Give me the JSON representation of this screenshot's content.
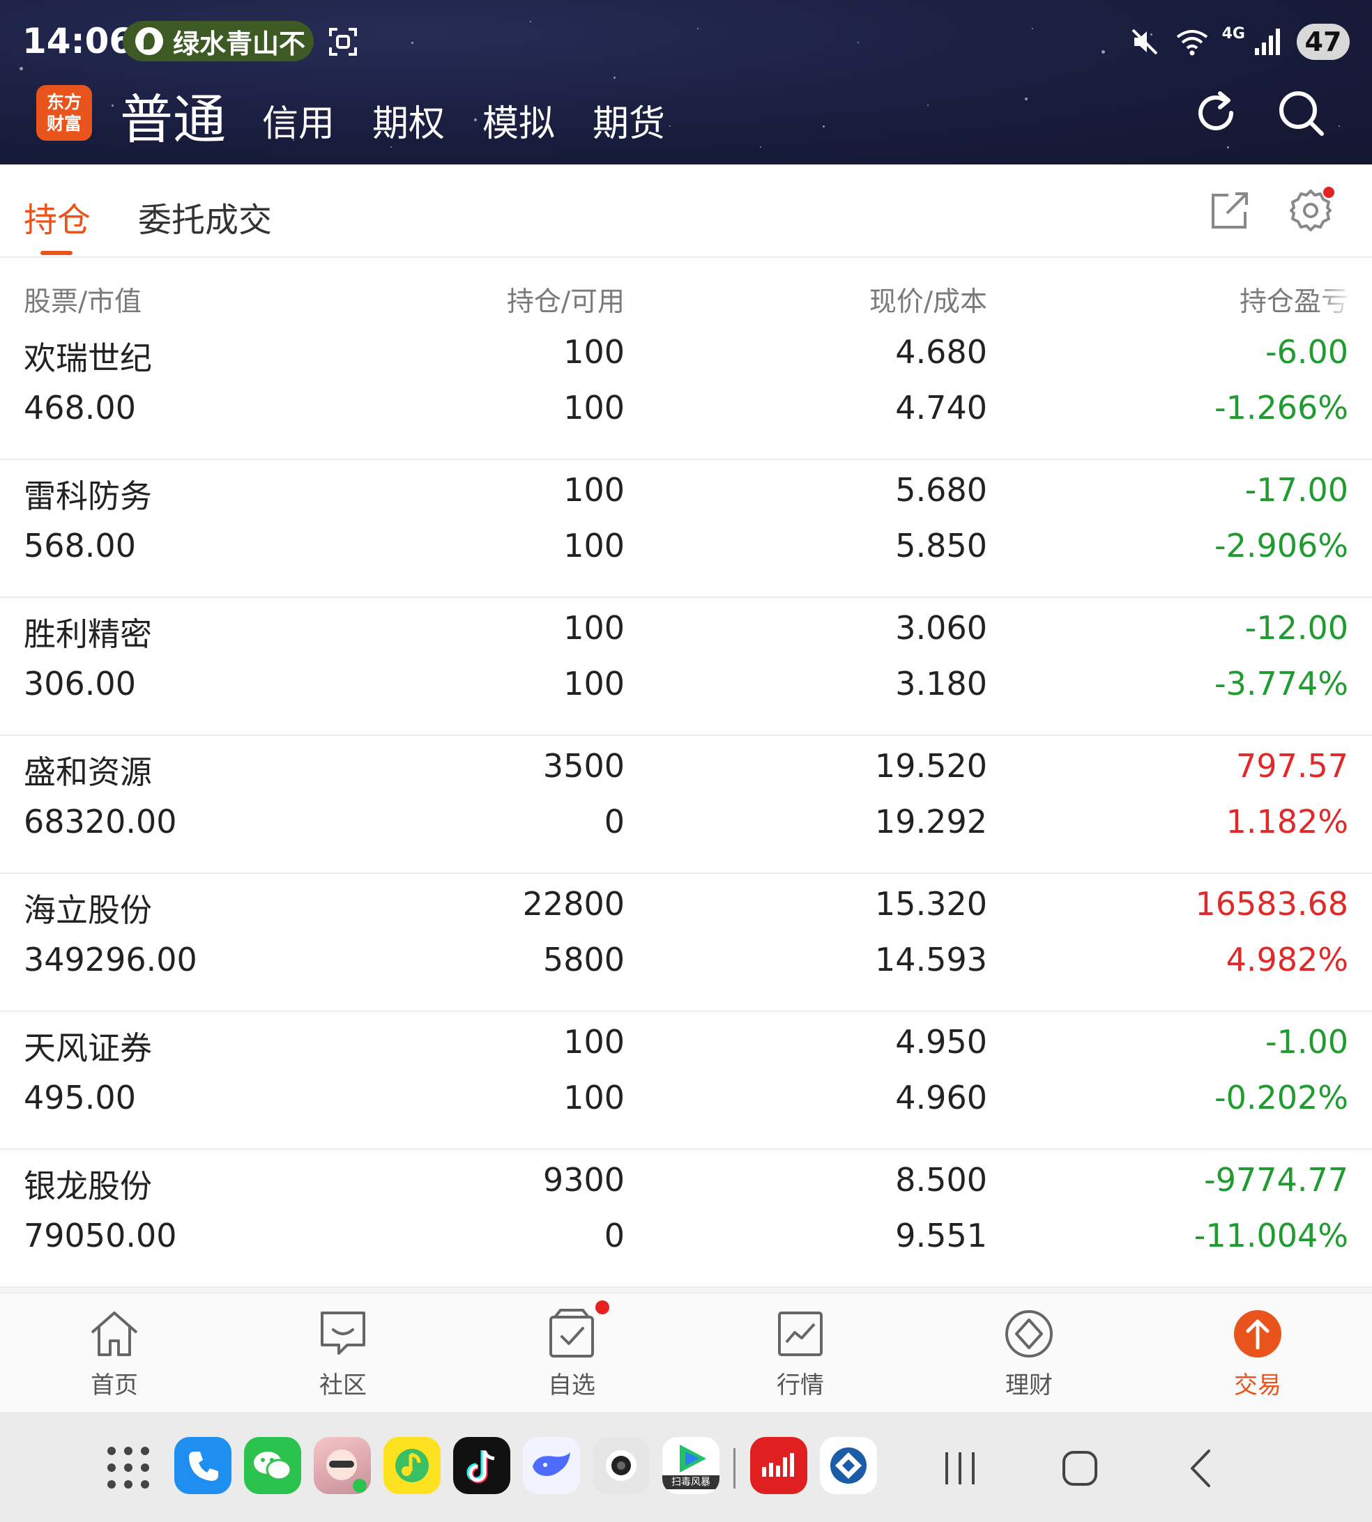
{
  "status_bar": {
    "time": "14:06",
    "pill_text": "绿水青山不",
    "network": "4G",
    "battery": "47"
  },
  "header": {
    "logo_line1": "东方",
    "logo_line2": "财富",
    "account_tabs": [
      "普通",
      "信用",
      "期权",
      "模拟",
      "期货"
    ],
    "active_tab": "普通"
  },
  "subtabs": {
    "items": [
      "持仓",
      "委托成交"
    ],
    "active": "持仓"
  },
  "table": {
    "headers": [
      "股票/市值",
      "持仓/可用",
      "现价/成本",
      "持仓盈亏"
    ],
    "rows": [
      {
        "name": "欢瑞世纪",
        "market_value": "468.00",
        "position": "100",
        "available": "100",
        "price": "4.680",
        "cost": "4.740",
        "pnl": "-6.00",
        "pnl_pct": "-1.266%",
        "dir": "loss"
      },
      {
        "name": "雷科防务",
        "market_value": "568.00",
        "position": "100",
        "available": "100",
        "price": "5.680",
        "cost": "5.850",
        "pnl": "-17.00",
        "pnl_pct": "-2.906%",
        "dir": "loss"
      },
      {
        "name": "胜利精密",
        "market_value": "306.00",
        "position": "100",
        "available": "100",
        "price": "3.060",
        "cost": "3.180",
        "pnl": "-12.00",
        "pnl_pct": "-3.774%",
        "dir": "loss"
      },
      {
        "name": "盛和资源",
        "market_value": "68320.00",
        "position": "3500",
        "available": "0",
        "price": "19.520",
        "cost": "19.292",
        "pnl": "797.57",
        "pnl_pct": "1.182%",
        "dir": "gain"
      },
      {
        "name": "海立股份",
        "market_value": "349296.00",
        "position": "22800",
        "available": "5800",
        "price": "15.320",
        "cost": "14.593",
        "pnl": "16583.68",
        "pnl_pct": "4.982%",
        "dir": "gain"
      },
      {
        "name": "天风证券",
        "market_value": "495.00",
        "position": "100",
        "available": "100",
        "price": "4.950",
        "cost": "4.960",
        "pnl": "-1.00",
        "pnl_pct": "-0.202%",
        "dir": "loss"
      },
      {
        "name": "银龙股份",
        "market_value": "79050.00",
        "position": "9300",
        "available": "0",
        "price": "8.500",
        "cost": "9.551",
        "pnl": "-9774.77",
        "pnl_pct": "-11.004%",
        "dir": "loss"
      }
    ]
  },
  "bottom_nav": {
    "items": [
      {
        "label": "首页",
        "icon": "home-icon"
      },
      {
        "label": "社区",
        "icon": "chat-icon"
      },
      {
        "label": "自选",
        "icon": "watchlist-icon"
      },
      {
        "label": "行情",
        "icon": "chart-icon"
      },
      {
        "label": "理财",
        "icon": "diamond-icon"
      },
      {
        "label": "交易",
        "icon": "trade-arrow-icon"
      }
    ],
    "active": "交易"
  },
  "dock": {
    "apps": [
      "phone-app-icon",
      "wechat-app-icon",
      "photo-app-icon",
      "music-app-icon",
      "tiktok-app-icon",
      "deepseek-app-icon",
      "camera-app-icon",
      "video-app-icon",
      "stock-app-icon",
      "bank-app-icon"
    ],
    "video_app_label": "扫毒风暴"
  },
  "colors": {
    "accent": "#e8541b",
    "loss": "#1f9b2f",
    "gain": "#e02a2a",
    "header_bg": "#181c3c"
  }
}
